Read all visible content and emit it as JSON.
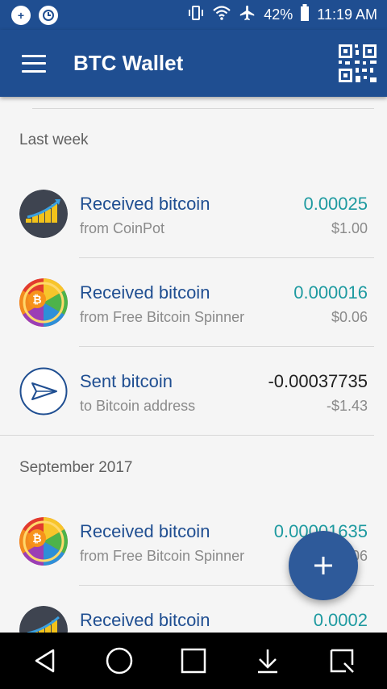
{
  "status_bar": {
    "battery": "42%",
    "time": "11:19 AM",
    "icons": [
      "notification-plus-icon",
      "notification-clock-icon",
      "vibrate-icon",
      "wifi-icon",
      "airplane-icon",
      "battery-icon"
    ]
  },
  "app_bar": {
    "title": "BTC Wallet",
    "menu_icon": "hamburger-menu-icon",
    "qr_icon": "qr-code-icon"
  },
  "sections": [
    {
      "header": "Last week",
      "transactions": [
        {
          "title": "Received bitcoin",
          "subtitle": "from CoinPot",
          "amount": "0.00025",
          "fiat": "$1.00",
          "direction": "received",
          "avatar": "coinpot-logo"
        },
        {
          "title": "Received bitcoin",
          "subtitle": "from Free Bitcoin Spinner",
          "amount": "0.000016",
          "fiat": "$0.06",
          "direction": "received",
          "avatar": "spinner-wheel-logo"
        },
        {
          "title": "Sent bitcoin",
          "subtitle": "to Bitcoin address",
          "amount": "-0.00037735",
          "fiat": "-$1.43",
          "direction": "sent",
          "avatar": "send-icon"
        }
      ]
    },
    {
      "header": "September 2017",
      "transactions": [
        {
          "title": "Received bitcoin",
          "subtitle": "from Free Bitcoin Spinner",
          "amount": "0.00001635",
          "fiat": "$0.06",
          "direction": "received",
          "avatar": "spinner-wheel-logo"
        },
        {
          "title": "Received bitcoin",
          "subtitle": "",
          "amount": "0.0002",
          "fiat": "",
          "direction": "received",
          "avatar": "coinpot-logo"
        }
      ]
    }
  ],
  "fab": {
    "icon": "plus-icon"
  },
  "nav_bar": {
    "icons": [
      "back-icon",
      "home-icon",
      "recents-icon",
      "download-icon",
      "screenshot-icon"
    ]
  },
  "colors": {
    "primary": "#1f4e91",
    "received_amount": "#1e9aa0",
    "sent_amount": "#212121",
    "title_text": "#1f4e91",
    "secondary_text": "#8a8a8a",
    "background": "#f5f5f5"
  }
}
